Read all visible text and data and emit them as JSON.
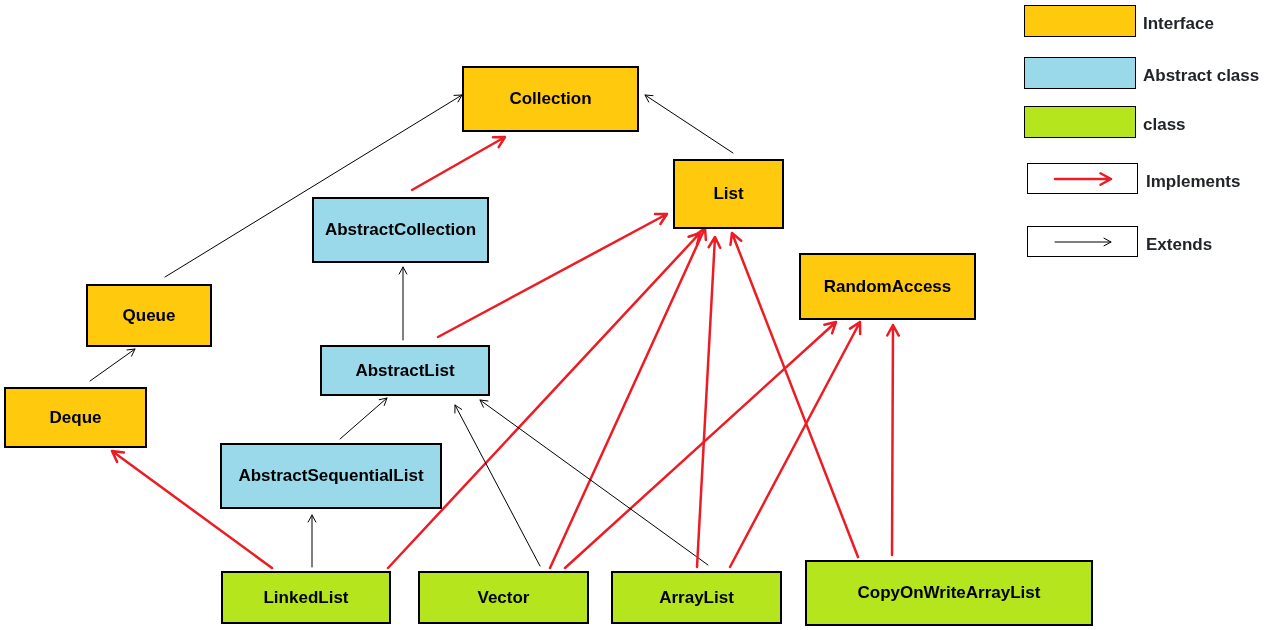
{
  "legend": [
    {
      "kind": "interface",
      "label": "Interface"
    },
    {
      "kind": "abstract",
      "label": "Abstract class"
    },
    {
      "kind": "class",
      "label": "class"
    },
    {
      "kind": "implements",
      "label": "Implements"
    },
    {
      "kind": "extends",
      "label": "Extends"
    }
  ],
  "nodes": [
    {
      "kind": "interface",
      "label": "Collection"
    },
    {
      "kind": "interface",
      "label": "List"
    },
    {
      "kind": "abstract",
      "label": "AbstractCollection"
    },
    {
      "kind": "interface",
      "label": "RandomAccess"
    },
    {
      "kind": "interface",
      "label": "Queue"
    },
    {
      "kind": "abstract",
      "label": "AbstractList"
    },
    {
      "kind": "interface",
      "label": "Deque"
    },
    {
      "kind": "abstract",
      "label": "AbstractSequentialList"
    },
    {
      "kind": "class",
      "label": "LinkedList"
    },
    {
      "kind": "class",
      "label": "Vector"
    },
    {
      "kind": "class",
      "label": "ArrayList"
    },
    {
      "kind": "class",
      "label": "CopyOnWriteArrayList"
    }
  ],
  "edges": [
    {
      "kind": "extends"
    },
    {
      "kind": "extends"
    },
    {
      "kind": "implements"
    },
    {
      "kind": "extends"
    },
    {
      "kind": "implements"
    },
    {
      "kind": "extends"
    },
    {
      "kind": "extends"
    },
    {
      "kind": "implements"
    },
    {
      "kind": "extends"
    },
    {
      "kind": "implements"
    },
    {
      "kind": "extends"
    },
    {
      "kind": "implements"
    },
    {
      "kind": "implements"
    },
    {
      "kind": "extends"
    },
    {
      "kind": "implements"
    },
    {
      "kind": "implements"
    },
    {
      "kind": "implements"
    },
    {
      "kind": "implements"
    }
  ]
}
